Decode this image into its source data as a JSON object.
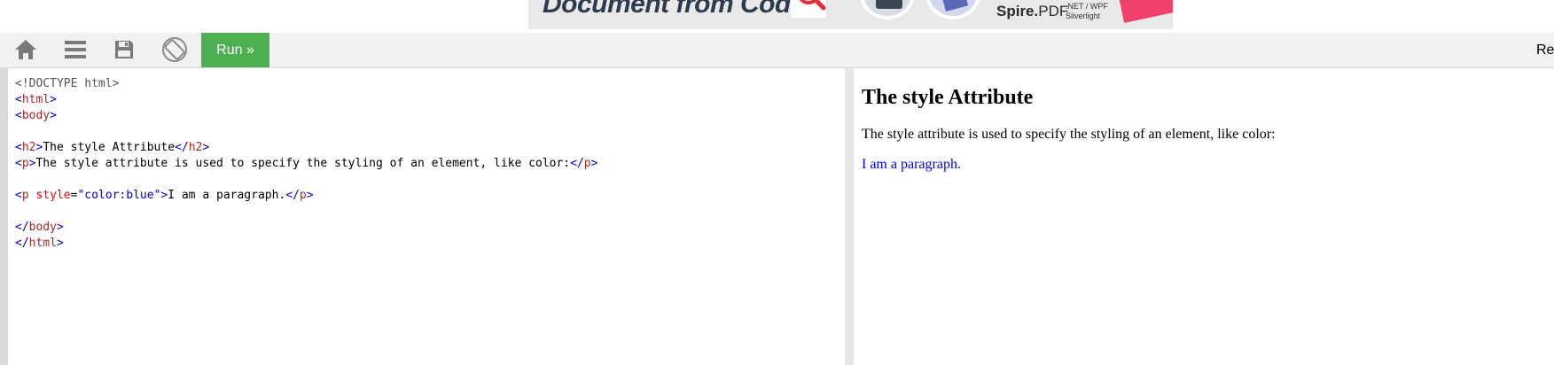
{
  "ad": {
    "headline": "Document from Code",
    "product_bold": "Spire.",
    "product_rest": "PDF",
    "platforms_line1": ".NET / WPF",
    "platforms_line2": "Silverlight"
  },
  "toolbar": {
    "home_icon": "home-icon",
    "menu_icon": "menu-icon",
    "save_icon": "save-icon",
    "rotate_icon": "rotate-icon",
    "run_label": "Run »",
    "result_size_label": "Re",
    "run_color": "#4caf50"
  },
  "editor": {
    "lines": [
      [
        {
          "c": "t-doctype",
          "t": "<!DOCTYPE html>"
        }
      ],
      [
        {
          "c": "t-br",
          "t": "<"
        },
        {
          "c": "t-tag",
          "t": "html"
        },
        {
          "c": "t-br",
          "t": ">"
        }
      ],
      [
        {
          "c": "t-br",
          "t": "<"
        },
        {
          "c": "t-tag",
          "t": "body"
        },
        {
          "c": "t-br",
          "t": ">"
        }
      ],
      [],
      [
        {
          "c": "t-br",
          "t": "<"
        },
        {
          "c": "t-tag",
          "t": "h2"
        },
        {
          "c": "t-br",
          "t": ">"
        },
        {
          "c": "t-text",
          "t": "The style Attribute"
        },
        {
          "c": "t-br",
          "t": "</"
        },
        {
          "c": "t-tag",
          "t": "h2"
        },
        {
          "c": "t-br",
          "t": ">"
        }
      ],
      [
        {
          "c": "t-br",
          "t": "<"
        },
        {
          "c": "t-tag",
          "t": "p"
        },
        {
          "c": "t-br",
          "t": ">"
        },
        {
          "c": "t-text",
          "t": "The style attribute is used to specify the styling of an element, like color:"
        },
        {
          "c": "t-br",
          "t": "</"
        },
        {
          "c": "t-tag",
          "t": "p"
        },
        {
          "c": "t-br",
          "t": ">"
        }
      ],
      [],
      [
        {
          "c": "t-br",
          "t": "<"
        },
        {
          "c": "t-tag",
          "t": "p"
        },
        {
          "c": "t-text",
          "t": " "
        },
        {
          "c": "t-attr",
          "t": "style"
        },
        {
          "c": "t-text",
          "t": "="
        },
        {
          "c": "t-val",
          "t": "\"color:blue\""
        },
        {
          "c": "t-br",
          "t": ">"
        },
        {
          "c": "t-text",
          "t": "I am a paragraph."
        },
        {
          "c": "t-br",
          "t": "</"
        },
        {
          "c": "t-tag",
          "t": "p"
        },
        {
          "c": "t-br",
          "t": ">"
        }
      ],
      [],
      [
        {
          "c": "t-br",
          "t": "</"
        },
        {
          "c": "t-tag",
          "t": "body"
        },
        {
          "c": "t-br",
          "t": ">"
        }
      ],
      [
        {
          "c": "t-br",
          "t": "</"
        },
        {
          "c": "t-tag",
          "t": "html"
        },
        {
          "c": "t-br",
          "t": ">"
        }
      ]
    ]
  },
  "result": {
    "heading": "The style Attribute",
    "paragraph1": "The style attribute is used to specify the styling of an element, like color:",
    "paragraph2": "I am a paragraph.",
    "paragraph2_color": "#0000ff"
  }
}
